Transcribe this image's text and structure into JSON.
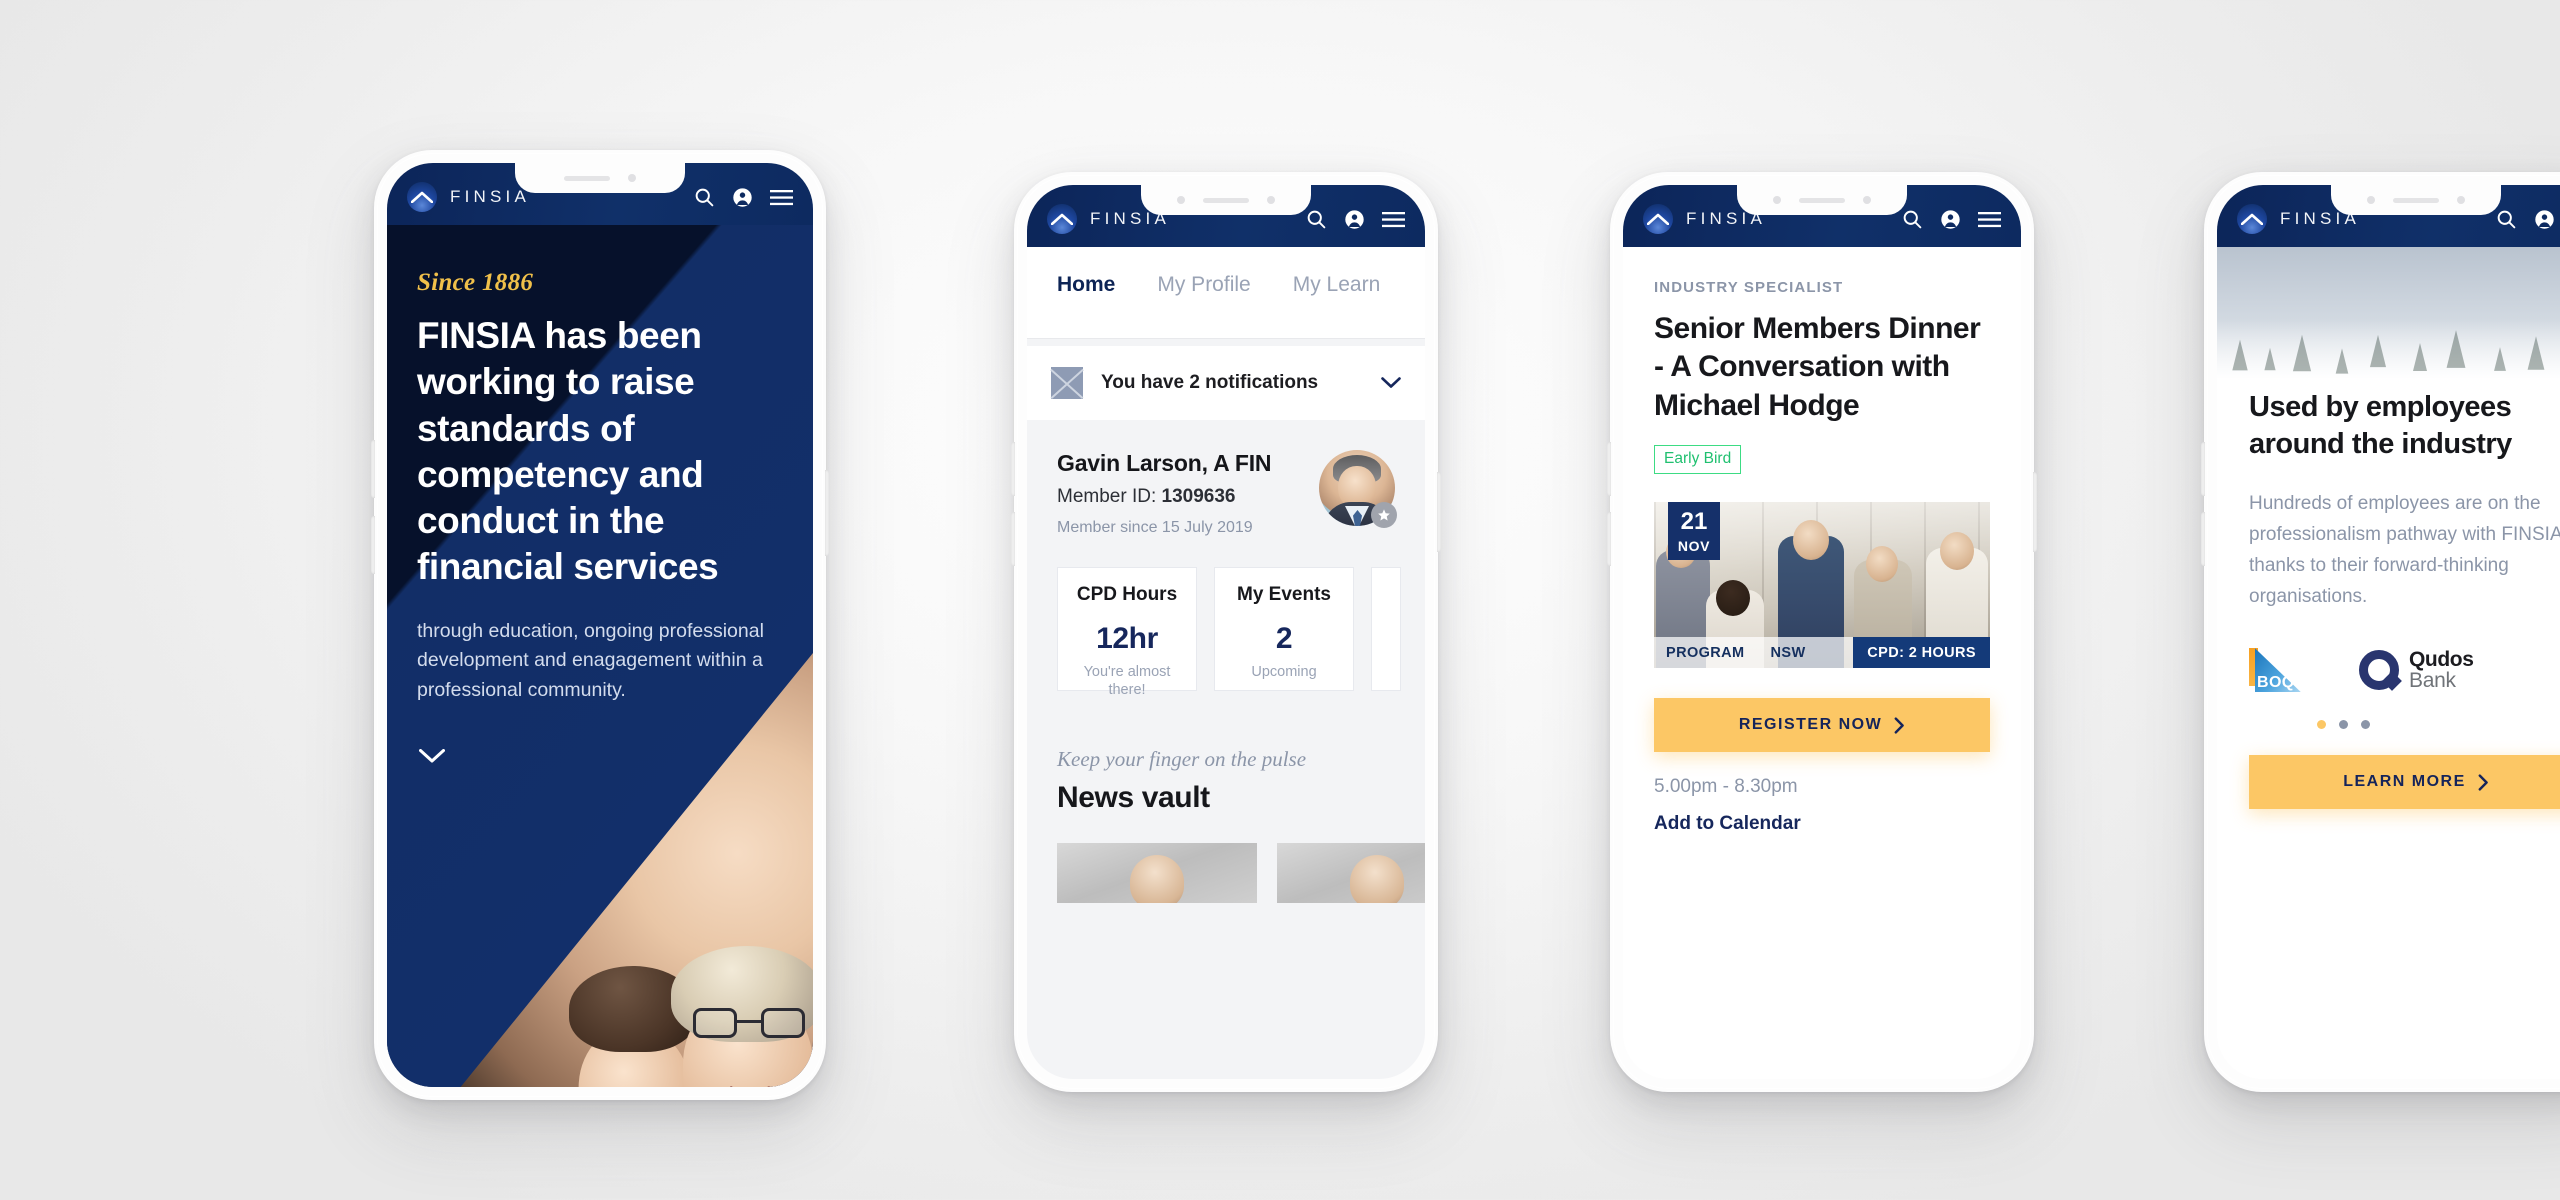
{
  "brand": {
    "wordmark": "FINSIA",
    "logo_icon": "finsia-chevron-logo",
    "navy": "#0d2a60",
    "accent_yellow": "#fcc765",
    "accent_gold": "#f0c04a",
    "green": "#20c070"
  },
  "appbar": {
    "search_icon": "search-icon",
    "account_icon": "account-icon",
    "menu_icon": "hamburger-menu-icon"
  },
  "phone1": {
    "hero": {
      "eyebrow": "Since 1886",
      "headline": "FINSIA has been working to raise standards of competency and conduct in the financial services",
      "body": "through education, ongoing professional development and enagagement within a professional community.",
      "scroll_icon": "chevron-down-icon"
    }
  },
  "phone2": {
    "tabs": [
      {
        "label": "Home",
        "active": true
      },
      {
        "label": "My Profile",
        "active": false
      },
      {
        "label": "My Learn",
        "active": false
      }
    ],
    "notification": {
      "thumb_icon": "image-placeholder-icon",
      "text": "You have 2 notifications",
      "expand_icon": "chevron-down-icon"
    },
    "member": {
      "name": "Gavin Larson, A FIN",
      "id_label": "Member ID:",
      "id_value": "1309636",
      "since": "Member since 15 July 2019",
      "avatar_icon": "member-avatar-photo",
      "badge_icon": "star-badge-icon"
    },
    "stats": [
      {
        "title": "CPD Hours",
        "value": "12hr",
        "sub": "You're almost there!"
      },
      {
        "title": "My Events",
        "value": "2",
        "sub": "Upcoming"
      },
      {
        "title": "",
        "value": "",
        "sub": ""
      }
    ],
    "news": {
      "kicker": "Keep your finger on the pulse",
      "title": "News vault"
    }
  },
  "phone3": {
    "event": {
      "kicker": "INDUSTRY SPECIALIST",
      "title": "Senior Members Dinner - A Conversation with Michael Hodge",
      "badge": "Early Bird",
      "date_day": "21",
      "date_month": "NOV",
      "meta_type": "PROGRAM",
      "meta_state": "NSW",
      "meta_cpd": "CPD: 2 HOURS",
      "register_label": "REGISTER NOW",
      "register_icon": "chevron-right-icon",
      "time": "5.00pm - 8.30pm",
      "calendar_link": "Add to Calendar",
      "photo_icon": "networking-event-photo"
    }
  },
  "phone4": {
    "partners": {
      "heading": "Used by employees around the industry",
      "body": "Hundreds of employees are on the professionalism pathway with FINSIA thanks to their forward-thinking organisations.",
      "logos": [
        {
          "name": "BOQ",
          "icon": "boq-logo",
          "wordmark": "BOQ"
        },
        {
          "name": "Qudos Bank",
          "icon": "qudos-bank-logo",
          "line1": "Qudos",
          "line2": "Bank"
        }
      ],
      "carousel": {
        "count": 3,
        "active_index": 0
      },
      "cta_label": "LEARN MORE",
      "cta_icon": "chevron-right-icon",
      "hero_icon": "misty-forest-photo"
    }
  }
}
